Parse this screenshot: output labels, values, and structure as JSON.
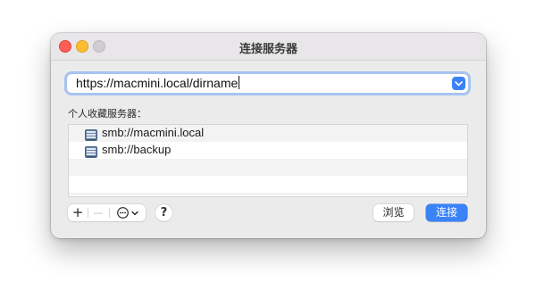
{
  "window": {
    "title": "连接服务器"
  },
  "server_address": {
    "value": "https://macmini.local/dirname"
  },
  "favorites": {
    "label": "个人收藏服务器：",
    "items": [
      {
        "label": "smb://macmini.local",
        "icon": "server-icon"
      },
      {
        "label": "smb://backup",
        "icon": "server-icon"
      }
    ]
  },
  "toolbar": {
    "add_label": "+",
    "remove_label": "—",
    "help_label": "?"
  },
  "buttons": {
    "browse_label": "浏览",
    "connect_label": "连接"
  },
  "colors": {
    "accent": "#3a82f7",
    "close": "#ff5f57",
    "minimize": "#febc2e",
    "zoom_disabled": "#cfcdcf"
  }
}
